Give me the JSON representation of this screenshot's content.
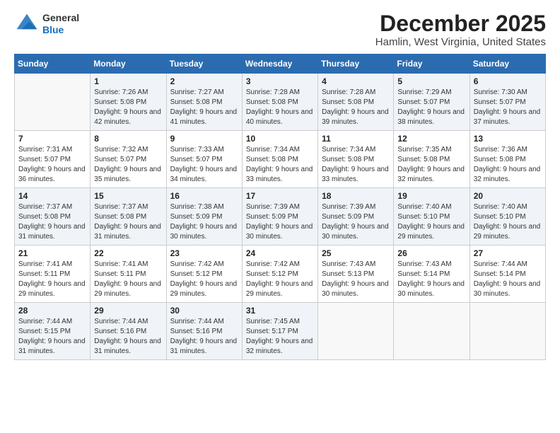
{
  "logo": {
    "general": "General",
    "blue": "Blue"
  },
  "header": {
    "month": "December 2025",
    "location": "Hamlin, West Virginia, United States"
  },
  "weekdays": [
    "Sunday",
    "Monday",
    "Tuesday",
    "Wednesday",
    "Thursday",
    "Friday",
    "Saturday"
  ],
  "weeks": [
    [
      {
        "day": "",
        "sunrise": "",
        "sunset": "",
        "daylight": ""
      },
      {
        "day": "1",
        "sunrise": "Sunrise: 7:26 AM",
        "sunset": "Sunset: 5:08 PM",
        "daylight": "Daylight: 9 hours and 42 minutes."
      },
      {
        "day": "2",
        "sunrise": "Sunrise: 7:27 AM",
        "sunset": "Sunset: 5:08 PM",
        "daylight": "Daylight: 9 hours and 41 minutes."
      },
      {
        "day": "3",
        "sunrise": "Sunrise: 7:28 AM",
        "sunset": "Sunset: 5:08 PM",
        "daylight": "Daylight: 9 hours and 40 minutes."
      },
      {
        "day": "4",
        "sunrise": "Sunrise: 7:28 AM",
        "sunset": "Sunset: 5:08 PM",
        "daylight": "Daylight: 9 hours and 39 minutes."
      },
      {
        "day": "5",
        "sunrise": "Sunrise: 7:29 AM",
        "sunset": "Sunset: 5:07 PM",
        "daylight": "Daylight: 9 hours and 38 minutes."
      },
      {
        "day": "6",
        "sunrise": "Sunrise: 7:30 AM",
        "sunset": "Sunset: 5:07 PM",
        "daylight": "Daylight: 9 hours and 37 minutes."
      }
    ],
    [
      {
        "day": "7",
        "sunrise": "Sunrise: 7:31 AM",
        "sunset": "Sunset: 5:07 PM",
        "daylight": "Daylight: 9 hours and 36 minutes."
      },
      {
        "day": "8",
        "sunrise": "Sunrise: 7:32 AM",
        "sunset": "Sunset: 5:07 PM",
        "daylight": "Daylight: 9 hours and 35 minutes."
      },
      {
        "day": "9",
        "sunrise": "Sunrise: 7:33 AM",
        "sunset": "Sunset: 5:07 PM",
        "daylight": "Daylight: 9 hours and 34 minutes."
      },
      {
        "day": "10",
        "sunrise": "Sunrise: 7:34 AM",
        "sunset": "Sunset: 5:08 PM",
        "daylight": "Daylight: 9 hours and 33 minutes."
      },
      {
        "day": "11",
        "sunrise": "Sunrise: 7:34 AM",
        "sunset": "Sunset: 5:08 PM",
        "daylight": "Daylight: 9 hours and 33 minutes."
      },
      {
        "day": "12",
        "sunrise": "Sunrise: 7:35 AM",
        "sunset": "Sunset: 5:08 PM",
        "daylight": "Daylight: 9 hours and 32 minutes."
      },
      {
        "day": "13",
        "sunrise": "Sunrise: 7:36 AM",
        "sunset": "Sunset: 5:08 PM",
        "daylight": "Daylight: 9 hours and 32 minutes."
      }
    ],
    [
      {
        "day": "14",
        "sunrise": "Sunrise: 7:37 AM",
        "sunset": "Sunset: 5:08 PM",
        "daylight": "Daylight: 9 hours and 31 minutes."
      },
      {
        "day": "15",
        "sunrise": "Sunrise: 7:37 AM",
        "sunset": "Sunset: 5:08 PM",
        "daylight": "Daylight: 9 hours and 31 minutes."
      },
      {
        "day": "16",
        "sunrise": "Sunrise: 7:38 AM",
        "sunset": "Sunset: 5:09 PM",
        "daylight": "Daylight: 9 hours and 30 minutes."
      },
      {
        "day": "17",
        "sunrise": "Sunrise: 7:39 AM",
        "sunset": "Sunset: 5:09 PM",
        "daylight": "Daylight: 9 hours and 30 minutes."
      },
      {
        "day": "18",
        "sunrise": "Sunrise: 7:39 AM",
        "sunset": "Sunset: 5:09 PM",
        "daylight": "Daylight: 9 hours and 30 minutes."
      },
      {
        "day": "19",
        "sunrise": "Sunrise: 7:40 AM",
        "sunset": "Sunset: 5:10 PM",
        "daylight": "Daylight: 9 hours and 29 minutes."
      },
      {
        "day": "20",
        "sunrise": "Sunrise: 7:40 AM",
        "sunset": "Sunset: 5:10 PM",
        "daylight": "Daylight: 9 hours and 29 minutes."
      }
    ],
    [
      {
        "day": "21",
        "sunrise": "Sunrise: 7:41 AM",
        "sunset": "Sunset: 5:11 PM",
        "daylight": "Daylight: 9 hours and 29 minutes."
      },
      {
        "day": "22",
        "sunrise": "Sunrise: 7:41 AM",
        "sunset": "Sunset: 5:11 PM",
        "daylight": "Daylight: 9 hours and 29 minutes."
      },
      {
        "day": "23",
        "sunrise": "Sunrise: 7:42 AM",
        "sunset": "Sunset: 5:12 PM",
        "daylight": "Daylight: 9 hours and 29 minutes."
      },
      {
        "day": "24",
        "sunrise": "Sunrise: 7:42 AM",
        "sunset": "Sunset: 5:12 PM",
        "daylight": "Daylight: 9 hours and 29 minutes."
      },
      {
        "day": "25",
        "sunrise": "Sunrise: 7:43 AM",
        "sunset": "Sunset: 5:13 PM",
        "daylight": "Daylight: 9 hours and 30 minutes."
      },
      {
        "day": "26",
        "sunrise": "Sunrise: 7:43 AM",
        "sunset": "Sunset: 5:14 PM",
        "daylight": "Daylight: 9 hours and 30 minutes."
      },
      {
        "day": "27",
        "sunrise": "Sunrise: 7:44 AM",
        "sunset": "Sunset: 5:14 PM",
        "daylight": "Daylight: 9 hours and 30 minutes."
      }
    ],
    [
      {
        "day": "28",
        "sunrise": "Sunrise: 7:44 AM",
        "sunset": "Sunset: 5:15 PM",
        "daylight": "Daylight: 9 hours and 31 minutes."
      },
      {
        "day": "29",
        "sunrise": "Sunrise: 7:44 AM",
        "sunset": "Sunset: 5:16 PM",
        "daylight": "Daylight: 9 hours and 31 minutes."
      },
      {
        "day": "30",
        "sunrise": "Sunrise: 7:44 AM",
        "sunset": "Sunset: 5:16 PM",
        "daylight": "Daylight: 9 hours and 31 minutes."
      },
      {
        "day": "31",
        "sunrise": "Sunrise: 7:45 AM",
        "sunset": "Sunset: 5:17 PM",
        "daylight": "Daylight: 9 hours and 32 minutes."
      },
      {
        "day": "",
        "sunrise": "",
        "sunset": "",
        "daylight": ""
      },
      {
        "day": "",
        "sunrise": "",
        "sunset": "",
        "daylight": ""
      },
      {
        "day": "",
        "sunrise": "",
        "sunset": "",
        "daylight": ""
      }
    ]
  ]
}
